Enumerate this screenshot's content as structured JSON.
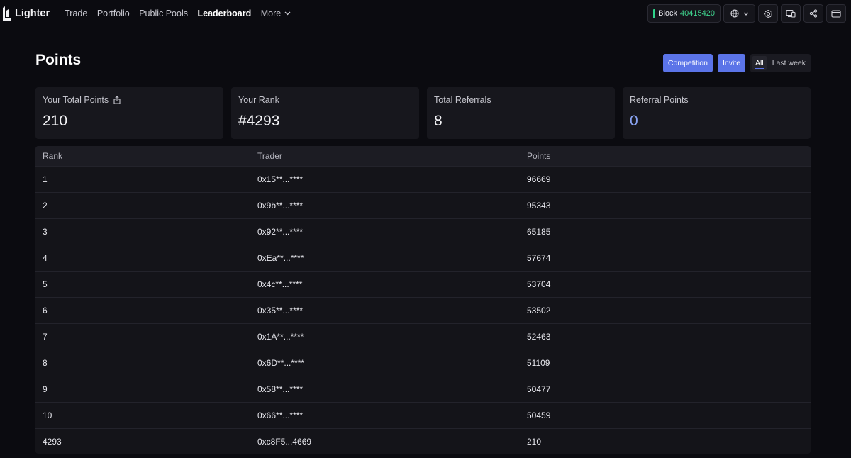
{
  "nav": {
    "brand": "Lighter",
    "links": [
      {
        "label": "Trade",
        "active": false
      },
      {
        "label": "Portfolio",
        "active": false
      },
      {
        "label": "Public Pools",
        "active": false
      },
      {
        "label": "Leaderboard",
        "active": true
      }
    ],
    "more_label": "More",
    "block_label": "Block",
    "block_number": "40415420",
    "icons": [
      "globe-icon",
      "chevron-down-icon",
      "settings-icon",
      "devices-icon",
      "share-icon",
      "wallet-icon"
    ]
  },
  "header": {
    "title": "Points",
    "competition_label": "Competition",
    "invite_label": "Invite",
    "range_tabs": [
      {
        "label": "All",
        "active": true
      },
      {
        "label": "Last week",
        "active": false
      }
    ]
  },
  "stats": [
    {
      "label": "Your Total Points",
      "value": "210",
      "icon": "share-out-icon"
    },
    {
      "label": "Your Rank",
      "value": "#4293"
    },
    {
      "label": "Total Referrals",
      "value": "8"
    },
    {
      "label": "Referral Points",
      "value": "0"
    }
  ],
  "table": {
    "columns": [
      "Rank",
      "Trader",
      "Points"
    ],
    "rows": [
      [
        "1",
        "0x15**...****",
        "96669"
      ],
      [
        "2",
        "0x9b**...****",
        "95343"
      ],
      [
        "3",
        "0x92**...****",
        "65185"
      ],
      [
        "4",
        "0xEa**...****",
        "57674"
      ],
      [
        "5",
        "0x4c**...****",
        "53704"
      ],
      [
        "6",
        "0x35**...****",
        "53502"
      ],
      [
        "7",
        "0x1A**...****",
        "52463"
      ],
      [
        "8",
        "0x6D**...****",
        "51109"
      ],
      [
        "9",
        "0x58**...****",
        "50477"
      ],
      [
        "10",
        "0x66**...****",
        "50459"
      ],
      [
        "4293",
        "0xc8F5...4669",
        "210"
      ]
    ]
  },
  "colors": {
    "background": "#0b0b10",
    "accent": "#5b74e8",
    "block_green": "#3fd68f",
    "referral_value": "#8aa4f3"
  }
}
